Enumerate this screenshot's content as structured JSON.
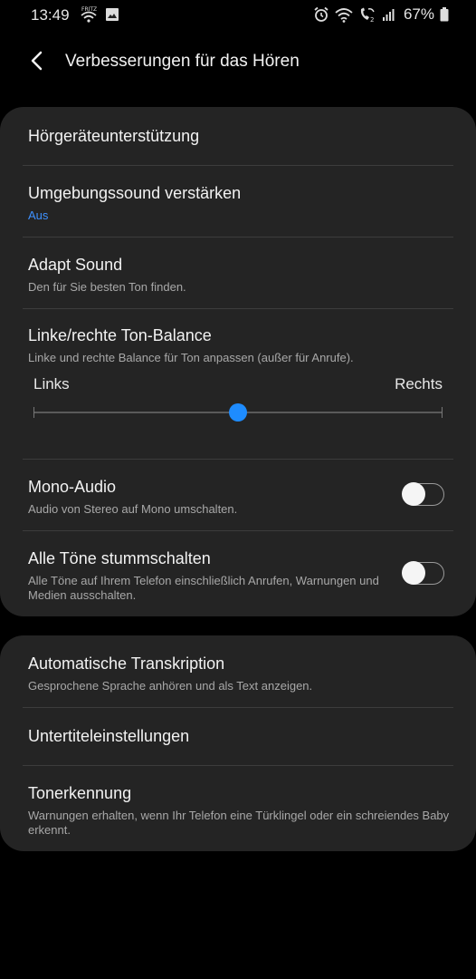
{
  "status_bar": {
    "time": "13:49",
    "battery": "67%",
    "icons_left": [
      "wifi-fritz-icon",
      "image-icon"
    ],
    "icons_right": [
      "alarm-icon",
      "wifi-icon",
      "wifi-calling-icon",
      "signal-icon",
      "battery-icon"
    ]
  },
  "header": {
    "title": "Verbesserungen für das Hören"
  },
  "section1": {
    "hearing_aid": {
      "title": "Hörgeräteunterstützung"
    },
    "ambient_sound": {
      "title": "Umgebungssound verstärken",
      "status": "Aus"
    },
    "adapt_sound": {
      "title": "Adapt Sound",
      "subtitle": "Den für Sie besten Ton finden."
    },
    "balance": {
      "title": "Linke/rechte Ton-Balance",
      "subtitle": "Linke und rechte Balance für Ton anpassen (außer für Anrufe).",
      "left_label": "Links",
      "right_label": "Rechts",
      "value": 0.5
    },
    "mono_audio": {
      "title": "Mono-Audio",
      "subtitle": "Audio von Stereo auf Mono umschalten.",
      "enabled": false
    },
    "mute_all": {
      "title": "Alle Töne stummschalten",
      "subtitle": "Alle Töne auf Ihrem Telefon einschließlich Anrufen, Warnungen und Medien ausschalten.",
      "enabled": false
    }
  },
  "section2": {
    "transcription": {
      "title": "Automatische Transkription",
      "subtitle": "Gesprochene Sprache anhören und als Text anzeigen."
    },
    "subtitles": {
      "title": "Untertiteleinstellungen"
    },
    "sound_detection": {
      "title": "Tonerkennung",
      "subtitle": "Warnungen erhalten, wenn Ihr Telefon eine Türklingel oder ein schreiendes Baby erkennt."
    }
  },
  "colors": {
    "accent": "#1e8cff",
    "status_blue": "#3e91ff",
    "card": "#242424",
    "background": "#000000"
  }
}
